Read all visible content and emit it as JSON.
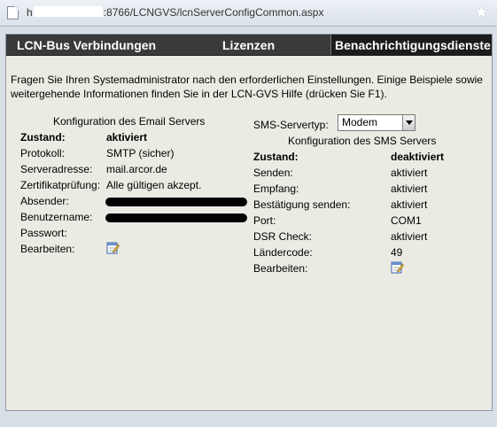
{
  "address_bar": {
    "url_prefix": "h",
    "url_suffix": ":8766/LCNGVS/lcnServerConfigCommon.aspx"
  },
  "tabs": [
    {
      "label": "LCN-Bus Verbindungen"
    },
    {
      "label": "Lizenzen"
    },
    {
      "label": "Benachrichtigungsdienste"
    }
  ],
  "intro_text": "Fragen Sie Ihren Systemadministrator nach den erforderlichen Einstellungen. Einige Beispiele sowie weitergehende Informationen finden Sie in der LCN-GVS Hilfe (drücken Sie F1).",
  "email": {
    "title": "Konfiguration des Email Servers",
    "rows": [
      {
        "label": "Zustand:",
        "value": "aktiviert"
      },
      {
        "label": "Protokoll:",
        "value": "SMTP (sicher)"
      },
      {
        "label": "Serveradresse:",
        "value": "mail.arcor.de"
      },
      {
        "label": "Zertifikatprüfung:",
        "value": "Alle gültigen akzept."
      },
      {
        "label": "Absender:",
        "value": ""
      },
      {
        "label": "Benutzername:",
        "value": ""
      },
      {
        "label": "Passwort:",
        "value": ""
      },
      {
        "label": "Bearbeiten:",
        "value": ""
      }
    ]
  },
  "sms": {
    "servertype_label": "SMS-Servertyp:",
    "servertype_value": "Modem",
    "title": "Konfiguration des SMS Servers",
    "rows": [
      {
        "label": "Zustand:",
        "value": "deaktiviert"
      },
      {
        "label": "Senden:",
        "value": "aktiviert"
      },
      {
        "label": "Empfang:",
        "value": "aktiviert"
      },
      {
        "label": "Bestätigung senden:",
        "value": "aktiviert"
      },
      {
        "label": "Port:",
        "value": "COM1"
      },
      {
        "label": "DSR Check:",
        "value": "aktiviert"
      },
      {
        "label": "Ländercode:",
        "value": "49"
      },
      {
        "label": "Bearbeiten:",
        "value": ""
      }
    ]
  },
  "icons": {
    "page": "page-icon",
    "favorite": "star-icon",
    "edit": "edit-icon"
  },
  "colors": {
    "tabbar_bg": "#3a3a3a",
    "active_tab_bg": "#1c1c1c",
    "content_bg": "#ecebe3"
  }
}
